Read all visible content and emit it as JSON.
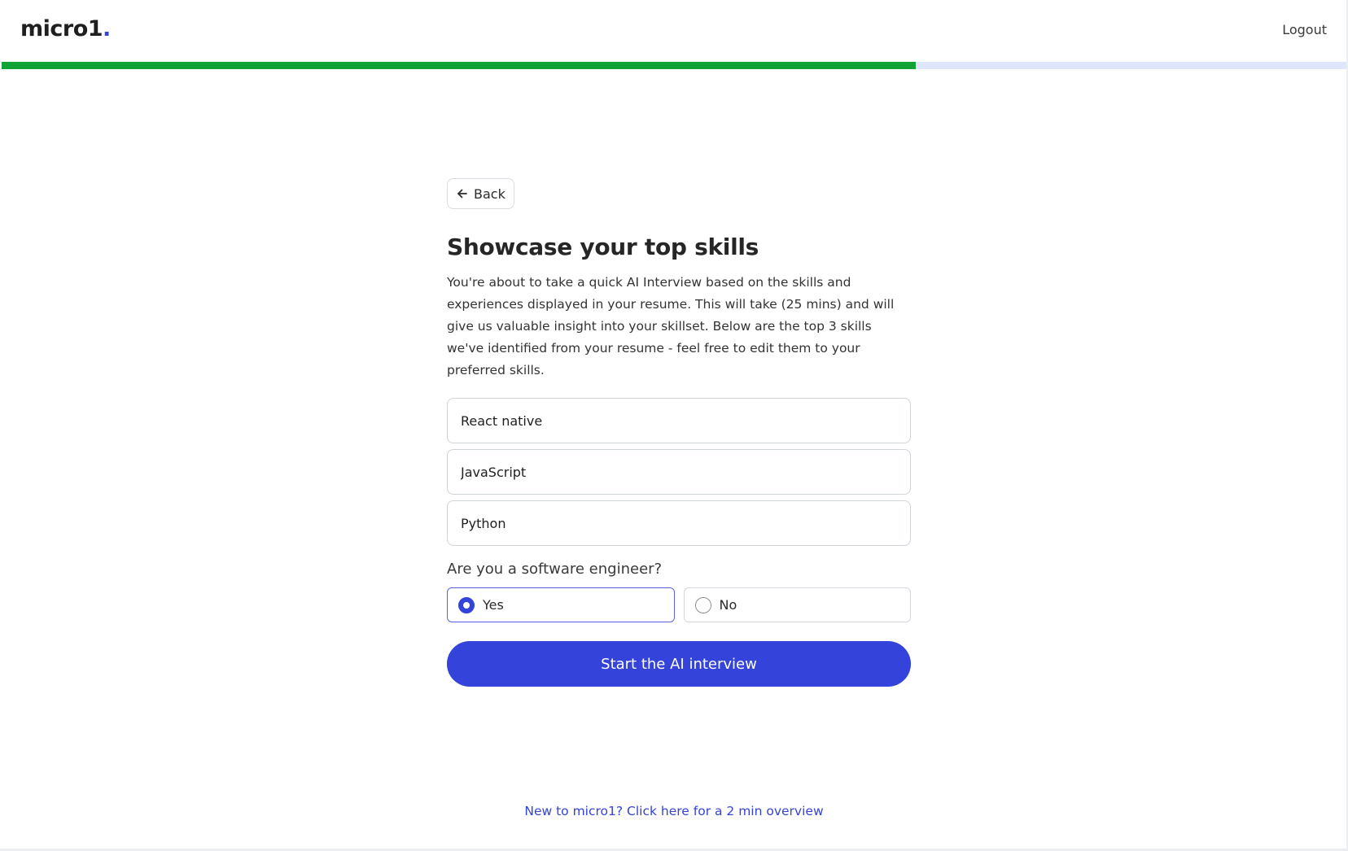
{
  "header": {
    "logo_text": "micro1",
    "logo_dot": ".",
    "logout_label": "Logout"
  },
  "progress": {
    "fraction": 0.68,
    "fill_color": "#11a335",
    "track_color": "#dfe6fb"
  },
  "main": {
    "back_label": "Back",
    "title": "Showcase your top skills",
    "description": "You're about to take a quick AI Interview based on the skills and experiences displayed in your resume. This will take (25 mins) and will give us valuable insight into your skillset. Below are the top 3 skills we've identified from your resume - feel free to edit them to your preferred skills.",
    "skills": [
      {
        "value": "React native"
      },
      {
        "value": "JavaScript"
      },
      {
        "value": "Python"
      }
    ],
    "question": "Are you a software engineer?",
    "options": [
      {
        "label": "Yes",
        "selected": true
      },
      {
        "label": "No",
        "selected": false
      }
    ],
    "start_button_label": "Start the AI interview"
  },
  "footer": {
    "overview_link": "New to micro1? Click here for a 2 min overview"
  },
  "colors": {
    "accent": "#3443d9",
    "progress_green": "#11a335"
  }
}
